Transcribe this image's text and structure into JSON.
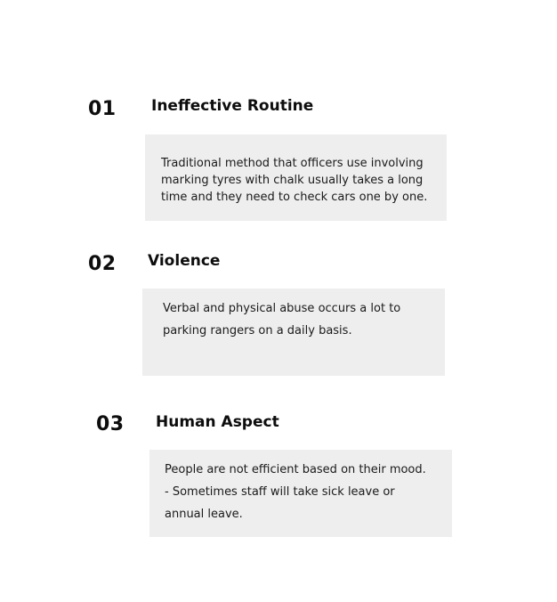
{
  "items": [
    {
      "number": "01",
      "title": "Ineffective Routine",
      "lines": [
        "Traditional method that officers use involving",
        "marking tyres with chalk usually takes a long",
        "time and they need to check cars one by one."
      ]
    },
    {
      "number": "02",
      "title": "Violence",
      "lines": [
        "Verbal and physical abuse occurs a lot to",
        "parking rangers on a daily basis."
      ]
    },
    {
      "number": "03",
      "title": "Human Aspect",
      "lines": [
        "People are not efficient based on their mood.",
        "- Sometimes staff will take sick leave or",
        "annual leave."
      ]
    }
  ]
}
